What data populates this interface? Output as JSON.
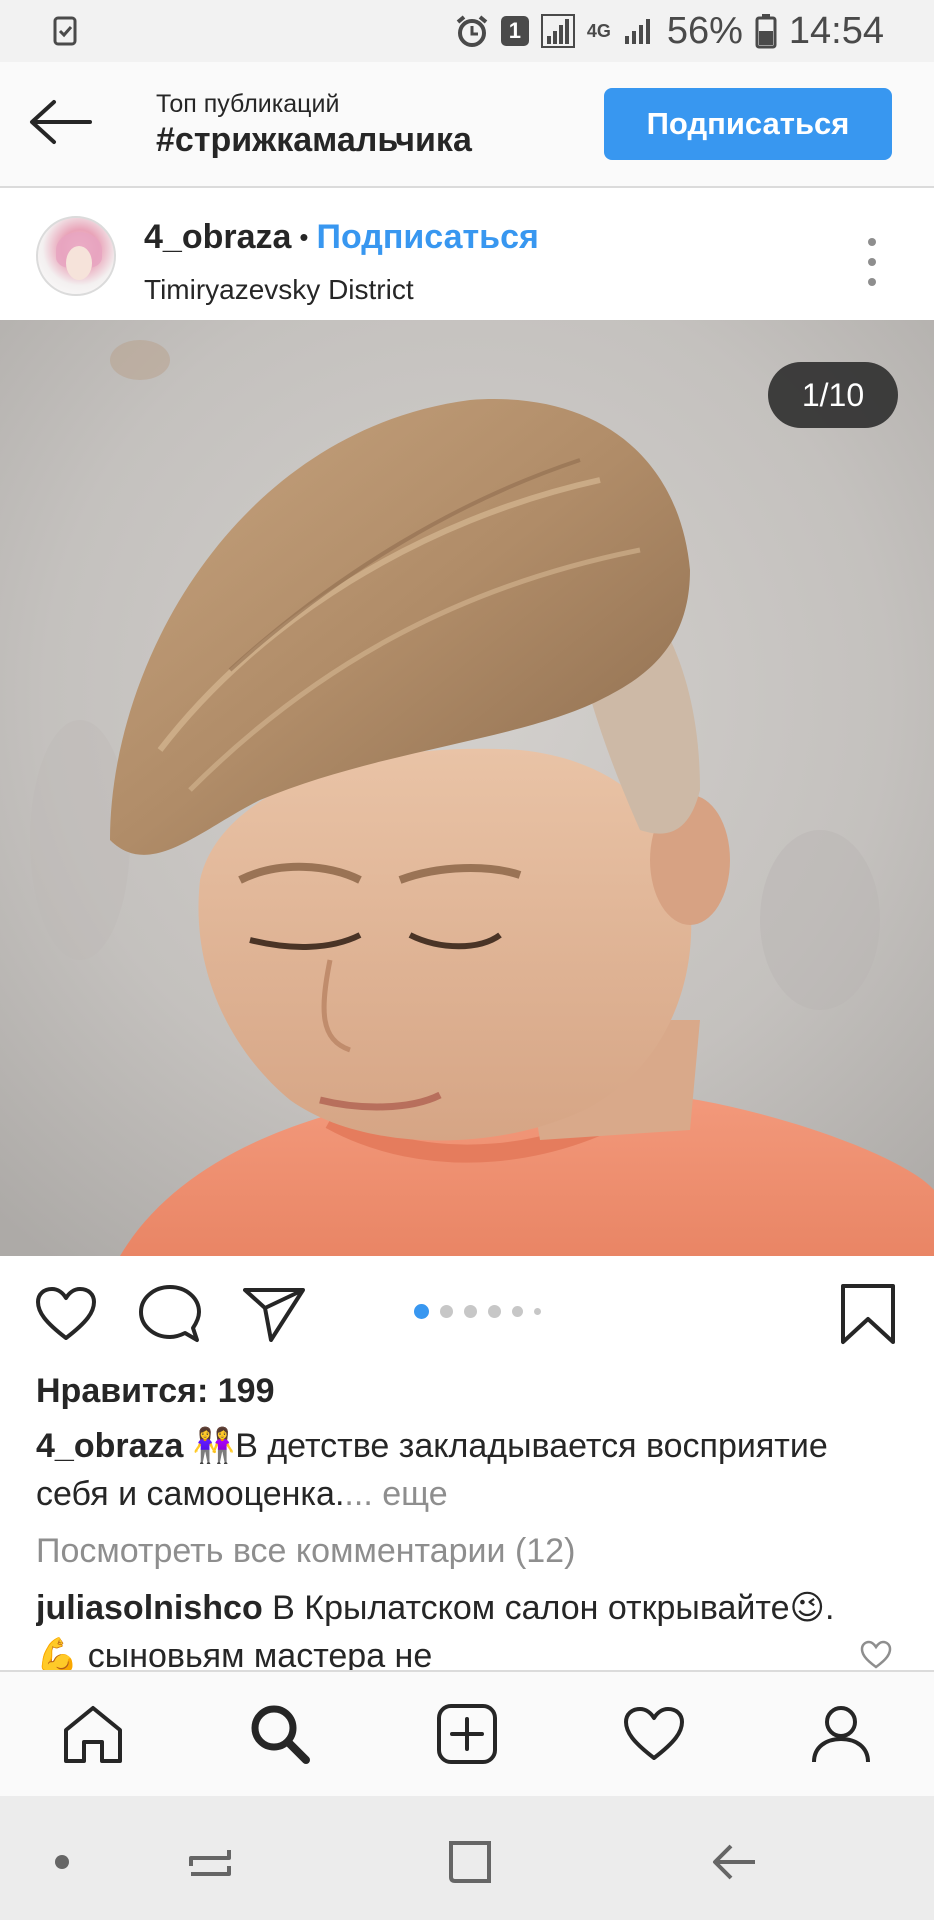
{
  "status_bar": {
    "battery": "56%",
    "time": "14:54",
    "sim_badge": "1",
    "network": "4G"
  },
  "header": {
    "subtitle": "Топ публикаций",
    "title": "#стрижкамальчика",
    "follow_label": "Подписаться"
  },
  "post": {
    "username": "4_obraza",
    "separator": "•",
    "follow_label": "Подписаться",
    "location": "Timiryazevsky District",
    "counter": "1/10",
    "likes": "Нравится: 199",
    "caption_user": "4_obraza",
    "caption_emoji": "👭",
    "caption_text": "В детстве закладывается восприятие себя и самооценка.",
    "caption_more": "... еще",
    "view_comments": "Посмотреть все комментарии (12)",
    "comment_user": "juliasolnishco",
    "comment_text": "В Крылатском салон открывайте😉.💪 сыновьям мастера не"
  },
  "carousel": {
    "total": 10,
    "active": 1
  },
  "colors": {
    "accent": "#3897f0",
    "text": "#262626",
    "muted": "#8e8e8e"
  },
  "icons": {
    "like": "heart-icon",
    "comment": "comment-icon",
    "share": "send-icon",
    "save": "bookmark-icon",
    "home": "home-icon",
    "search": "search-icon",
    "add": "add-post-icon",
    "activity": "heart-icon",
    "profile": "profile-icon"
  }
}
